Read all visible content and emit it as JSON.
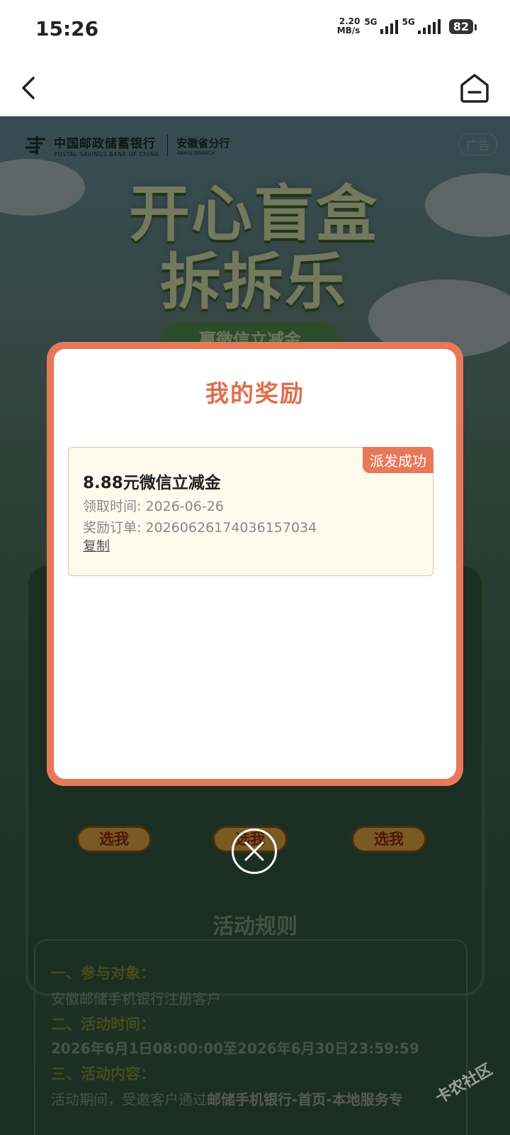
{
  "status_bar": {
    "time": "15:26",
    "speed_value": "2.20",
    "speed_unit": "MB/s",
    "network_1": "5G",
    "network_2": "5G",
    "battery": "82"
  },
  "nav": {
    "back_icon": "chevron-left-icon",
    "home_icon": "home-icon"
  },
  "background_page": {
    "bank_name_cn": "中国邮政储蓄银行",
    "bank_name_en": "POSTAL SAVINGS BANK OF CHINA",
    "branch_cn": "安徽省分行",
    "branch_en": "ANHUI BRANCH",
    "ad_label": "广告",
    "hero_line1": "开心盲盒",
    "hero_line2": "拆拆乐",
    "hero_subtitle": "赢微信立减金",
    "choose_buttons": [
      "选我",
      "选我",
      "选我"
    ],
    "rules_title": "活动规则",
    "rules": {
      "h1": "一、参与对象：",
      "p1": "安徽邮储手机银行注册客户",
      "h2": "二、活动时间：",
      "p2": "2026年6月1日08:00:00至2026年6月30日23:59:59",
      "h3": "三、活动内容：",
      "p3_prefix": "活动期间，受邀客户通过",
      "p3_bold": "邮储手机银行-首页-本地服务专"
    }
  },
  "modal": {
    "title": "我的奖励",
    "reward": {
      "badge": "派发成功",
      "name": "8.88元微信立减金",
      "time_label": "领取时间: ",
      "time_value": "2026-06-26",
      "order_label": "奖励订单: ",
      "order_value": "20260626174036157034",
      "copy_label": "复制"
    },
    "close_icon": "close-circle-icon"
  },
  "watermark": "卡农社区",
  "colors": {
    "accent": "#e8785a",
    "title": "#e26c49",
    "card_bg": "#fffbec"
  }
}
